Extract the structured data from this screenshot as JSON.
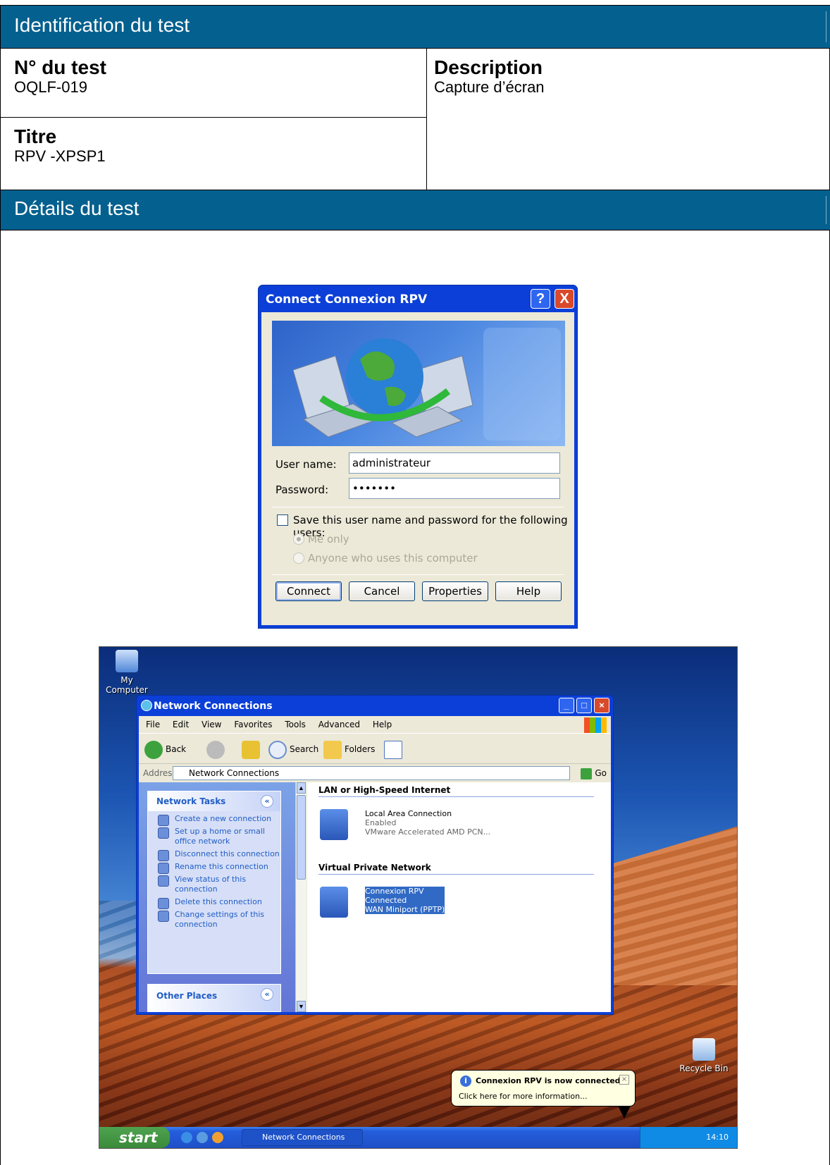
{
  "header": {
    "section1": "Identification du test",
    "num_label": "N° du test",
    "num_value": "OQLF-019",
    "desc_label": "Description",
    "desc_value": "Capture d’écran",
    "title_label": "Titre",
    "title_value": "RPV -XPSP1",
    "section2": "Détails du test"
  },
  "dialog": {
    "title": "Connect Connexion RPV",
    "help_glyph": "?",
    "close_glyph": "X",
    "username_label": "User name:",
    "username_value": "administrateur",
    "password_label": "Password:",
    "password_value": "•••••••",
    "save_label": "Save this user name and password for the following users:",
    "save_checked": false,
    "radio_me": "Me only",
    "radio_anyone": "Anyone who uses this computer",
    "buttons": {
      "connect": "Connect",
      "cancel": "Cancel",
      "properties": "Properties",
      "help": "Help"
    }
  },
  "desktop": {
    "icon_my_computer": "My Computer",
    "icon_recycle": "Recycle Bin",
    "window": {
      "title": "Network Connections",
      "menu": [
        "File",
        "Edit",
        "View",
        "Favorites",
        "Tools",
        "Advanced",
        "Help"
      ],
      "toolbar": {
        "back": "Back",
        "search": "Search",
        "folders": "Folders"
      },
      "address_label": "Address",
      "address_value": "Network Connections",
      "go": "Go",
      "tasks_header": "Network Tasks",
      "tasks": [
        "Create a new connection",
        "Set up a home or small office network",
        "Disconnect this connection",
        "Rename this connection",
        "View status of this connection",
        "Delete this connection",
        "Change settings of this connection"
      ],
      "other_places": "Other Places",
      "group_lan": "LAN or High-Speed Internet",
      "lan": {
        "name": "Local Area Connection",
        "status": "Enabled",
        "device": "VMware Accelerated AMD PCN..."
      },
      "group_vpn": "Virtual Private Network",
      "vpn": {
        "name": "Connexion RPV",
        "status": "Connected",
        "device": "WAN Miniport (PPTP)"
      }
    },
    "balloon": {
      "title": "Connexion RPV is now connected",
      "body": "Click here for more information..."
    },
    "taskbar": {
      "start": "start",
      "task": "Network Connections",
      "clock": "14:10"
    }
  }
}
